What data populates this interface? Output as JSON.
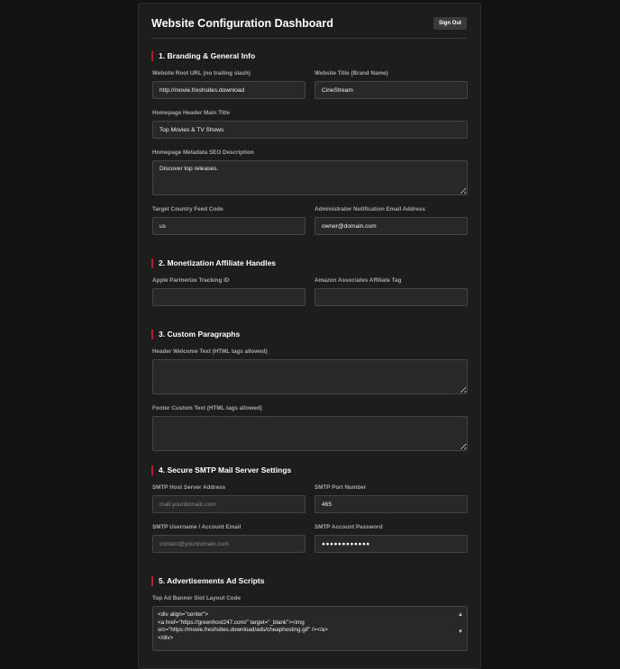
{
  "header": {
    "title": "Website Configuration Dashboard",
    "signout_label": "Sign Out"
  },
  "sections": {
    "branding": {
      "title": "1. Branding & General Info",
      "root_url_label": "Website Root URL (no trailing slash)",
      "root_url_value": "http://movie.freshsites.download",
      "site_title_label": "Website Title (Brand Name)",
      "site_title_value": "CineStream",
      "header_title_label": "Homepage Header Main Title",
      "header_title_value": "Top Movies & TV Shows",
      "seo_label": "Homepage Metadata SEO Description",
      "seo_value": "Discover top releases.",
      "country_label": "Target Country Feed Code",
      "country_value": "us",
      "admin_email_label": "Administrator Notification Email Address",
      "admin_email_value": "owner@domain.com"
    },
    "monetization": {
      "title": "2. Monetization Affiliate Handles",
      "apple_label": "Apple Partnerize Tracking ID",
      "apple_value": "",
      "amazon_label": "Amazon Associates Affiliate Tag",
      "amazon_value": ""
    },
    "paragraphs": {
      "title": "3. Custom Paragraphs",
      "header_text_label": "Header Welcome Text (HTML tags allowed)",
      "header_text_value": "",
      "footer_text_label": "Footer Custom Text (HTML tags allowed)",
      "footer_text_value": ""
    },
    "smtp": {
      "title": "4. Secure SMTP Mail Server Settings",
      "host_label": "SMTP Host Server Address",
      "host_placeholder": "mail.yourdomain.com",
      "port_label": "SMTP Port Number",
      "port_value": "465",
      "username_label": "SMTP Username / Account Email",
      "username_placeholder": "contact@yourdomain.com",
      "password_label": "SMTP Account Password",
      "password_value": "●●●●●●●●●●●●"
    },
    "ads": {
      "title": "5. Advertisements Ad Scripts",
      "top_banner_label": "Top Ad Banner Slot Layout Code",
      "code_line_1": "<div align=\"center\">",
      "code_line_2": "<a href=\"https://greenhost247.com/\" target=\"_blank\"><img src=\"https://movie.freshsites.download/ads/cheaphosting.gif\" /></a>",
      "code_line_3": "</div>"
    }
  }
}
